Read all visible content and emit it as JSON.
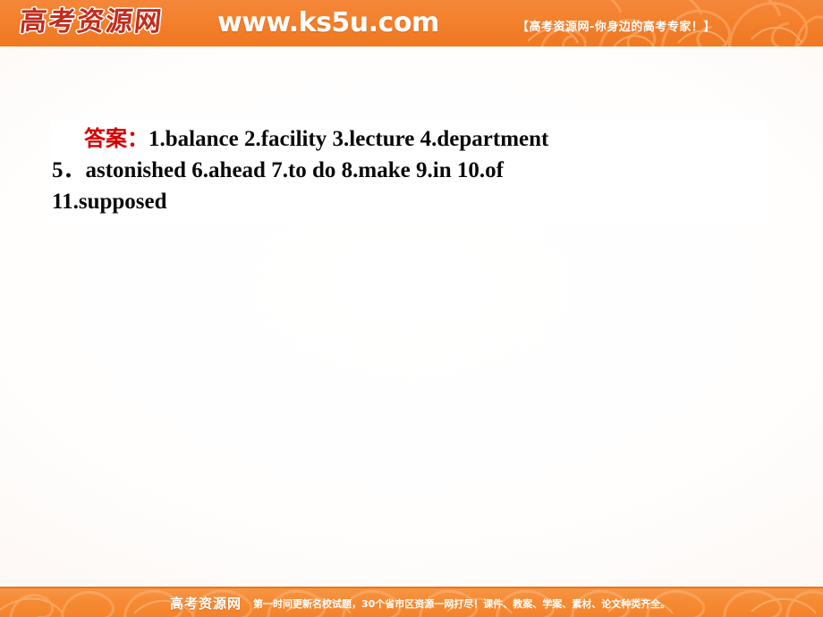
{
  "slide": {
    "background_center": "#ffffff",
    "background_edge": "#fbeee9"
  },
  "header": {
    "bar_color": "#f4822f",
    "logo_text": "高考资源网",
    "logo_color": "#c32b1b",
    "url_text": "www.ks5u.com",
    "url_color": "#ffffff",
    "tagline": "【高考资源网-你身边的高考专家！】",
    "decor_icon": "swirl-pattern-icon"
  },
  "answer": {
    "label": "答案：",
    "label_color": "#d60000",
    "text_color": "#0a0a0a",
    "items": [
      {
        "number": "1.",
        "value": "balance"
      },
      {
        "number": "2.",
        "value": "facility"
      },
      {
        "number": "3.",
        "value": "lecture"
      },
      {
        "number": "4.",
        "value": "department"
      },
      {
        "number": "5．",
        "value": "astonished"
      },
      {
        "number": "6.",
        "value": "ahead"
      },
      {
        "number": "7.",
        "value": "to do"
      },
      {
        "number": "8.",
        "value": "make"
      },
      {
        "number": "9.",
        "value": "in"
      },
      {
        "number": "10.",
        "value": "of"
      },
      {
        "number": "11.",
        "value": "supposed"
      }
    ],
    "line1": "1.balance    2.facility    3.lecture    4.department",
    "line2": "5．astonished    6.ahead    7.to do    8.make    9.in    10.of",
    "line3": "11.supposed"
  },
  "footer": {
    "bar_color": "#f4832a",
    "logo_text": "高考资源网",
    "tagline": "第一时间更新名校试题，30个省市区资源一网打尽！课件、教案、学案、素材、论文种类齐全。",
    "decor_icon": "swirl-pattern-icon"
  }
}
